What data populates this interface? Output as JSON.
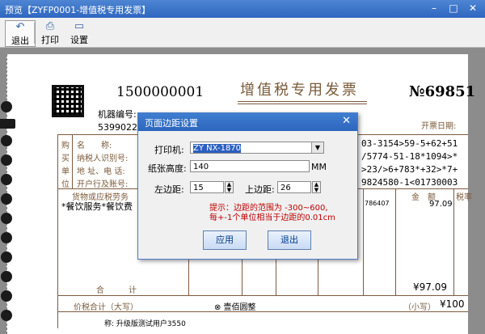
{
  "window": {
    "title": "预览【ZYFP0001-增值税专用发票】",
    "min": "–",
    "max": "□",
    "close": "✕"
  },
  "toolbar": {
    "exit": "退出",
    "print": "打印",
    "setup": "设置"
  },
  "invoice": {
    "number_left": "1500000001",
    "title": "增值税专用发票",
    "no_prefix": "№",
    "no_value": "69851",
    "machine_no_label": "机器编号:",
    "code_partial": "5399022",
    "issue_date_label": "开票日期:",
    "buyer_side": [
      "购",
      "买",
      "单",
      "位"
    ],
    "buyer_labels": [
      "名　　称:",
      "纳税人识别号:",
      "地 址、电 话:",
      "开户行及账号:"
    ],
    "cipher": [
      "03-3154>59-5+62+51",
      "/5774-51-18*1094>*",
      ">23/>6+783*+32>*7+",
      "9824580-1<01730003"
    ],
    "goods_header": "货物或应税劳务",
    "amount_header": "金　额",
    "tax_header": "税率",
    "item_line": "*餐饮服务*餐饮费",
    "price_partial": "786407",
    "amount_value": "97.09",
    "total_label": "合　　　计",
    "total_value": "¥97.09",
    "price_tax_label": "价税合计（大写）",
    "price_tax_words": "⊗ 壹佰圆整",
    "small_label": "（小写）",
    "small_value": "¥100",
    "seller_partial": "称: 升级版测试用户3550"
  },
  "dialog": {
    "title": "页面边距设置",
    "close": "✕",
    "printer_label": "打印机:",
    "printer_value": "ZY NX-1870",
    "paper_height_label": "纸张高度:",
    "paper_height_value": "140",
    "unit": "MM",
    "left_margin_label": "左边距:",
    "left_margin_value": "15",
    "top_margin_label": "上边距:",
    "top_margin_value": "26",
    "hint_line1": "提示：边距的范围为 -300~600,",
    "hint_line2": "每+-1个单位相当于边距的0.01cm",
    "apply": "应用",
    "exit": "退出"
  }
}
